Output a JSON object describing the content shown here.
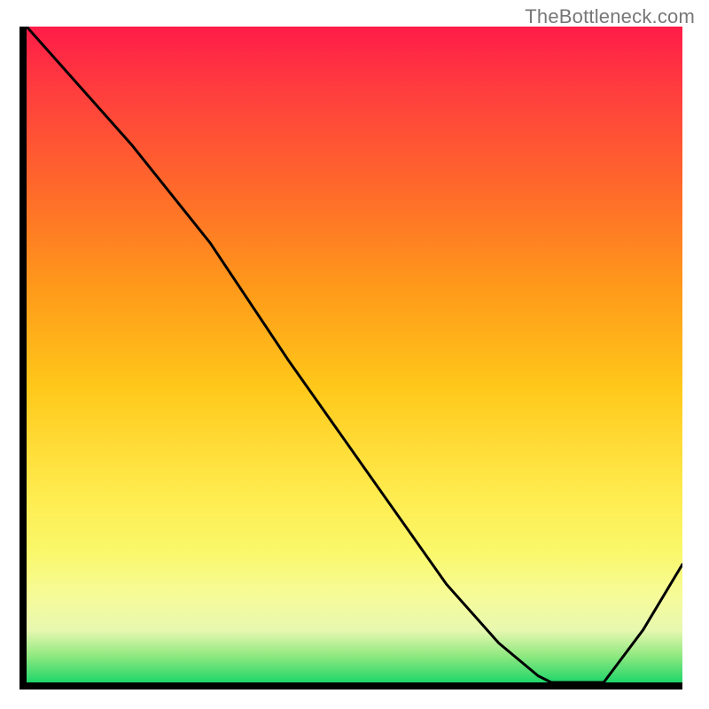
{
  "watermark": "TheBottleneck.com",
  "chart_data": {
    "type": "line",
    "title": "",
    "xlabel": "",
    "ylabel": "",
    "xlim": [
      0,
      100
    ],
    "ylim": [
      0,
      100
    ],
    "marker_label": "",
    "flat_region_x": [
      80,
      88
    ],
    "series": [
      {
        "name": "bottleneck-curve",
        "x": [
          0,
          8,
          16,
          24,
          28,
          40,
          52,
          64,
          72,
          78,
          80,
          84,
          88,
          94,
          100
        ],
        "y": [
          100,
          91,
          82,
          72,
          67,
          49,
          32,
          15,
          6,
          1,
          0,
          0,
          0,
          8,
          18
        ]
      }
    ],
    "gradient_stops": [
      {
        "pos": 0.0,
        "color": "#ff1c48"
      },
      {
        "pos": 0.1,
        "color": "#ff3e3e"
      },
      {
        "pos": 0.25,
        "color": "#ff6a2a"
      },
      {
        "pos": 0.4,
        "color": "#ff9a1a"
      },
      {
        "pos": 0.55,
        "color": "#ffc81a"
      },
      {
        "pos": 0.7,
        "color": "#ffe94a"
      },
      {
        "pos": 0.8,
        "color": "#faf86a"
      },
      {
        "pos": 0.87,
        "color": "#f6fb9a"
      },
      {
        "pos": 0.92,
        "color": "#e8f8b0"
      },
      {
        "pos": 0.96,
        "color": "#8ee880"
      },
      {
        "pos": 1.0,
        "color": "#1fd66a"
      }
    ]
  }
}
